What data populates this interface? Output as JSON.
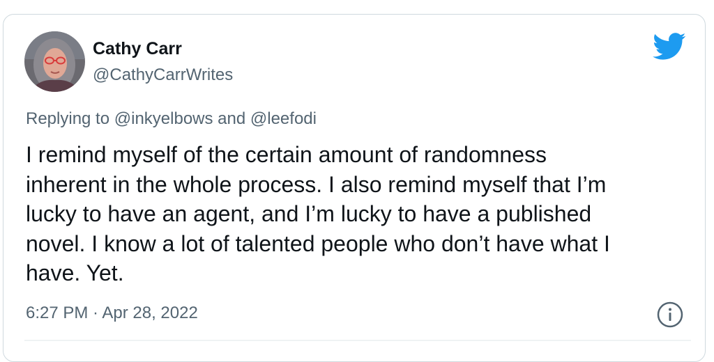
{
  "author": {
    "name": "Cathy Carr",
    "handle": "@CathyCarrWrites"
  },
  "reply": {
    "prefix": "Replying to ",
    "mention_1": "@inkyelbows",
    "joiner": " and ",
    "mention_2": "@leefodi"
  },
  "tweet": {
    "text": "I remind myself of the certain amount of randomness\ninherent in the whole process. I also remind myself that I’m\nlucky to have an agent, and I’m lucky to have a published\nnovel. I know a lot of talented people who don’t have what I\nhave. Yet."
  },
  "meta": {
    "timestamp": "6:27 PM · Apr 28, 2022"
  },
  "icons": {
    "brand": "twitter-bird-icon",
    "info": "info-icon"
  },
  "colors": {
    "brand_blue": "#1d9bf0",
    "text_primary": "#0f1419",
    "text_secondary": "#536471"
  }
}
